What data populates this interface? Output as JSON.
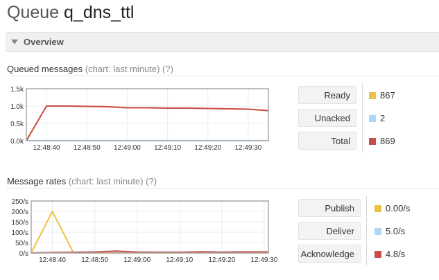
{
  "page": {
    "title_prefix": "Queue",
    "queue_name": "q_dns_ttl",
    "section_label": "Overview"
  },
  "queued": {
    "heading": "Queued messages",
    "chart_note": "(chart: last minute)",
    "help": "(?)",
    "stats": [
      {
        "label": "Ready",
        "value": "867",
        "color": "#edc240"
      },
      {
        "label": "Unacked",
        "value": "2",
        "color": "#afd8f8"
      },
      {
        "label": "Total",
        "value": "869",
        "color": "#cb4b4b"
      }
    ]
  },
  "rates": {
    "heading": "Message rates",
    "chart_note": "(chart: last minute)",
    "help": "(?)",
    "stats": [
      {
        "label": "Publish",
        "value": "0.00/s",
        "color": "#edc240"
      },
      {
        "label": "Deliver",
        "value": "5.0/s",
        "color": "#afd8f8"
      },
      {
        "label": "Acknowledge",
        "value": "4.8/s",
        "color": "#cb4b4b"
      }
    ]
  },
  "chart_data": [
    {
      "type": "line",
      "y_ticks": [
        "1.5k",
        "1.0k",
        "0.5k",
        "0.0k"
      ],
      "x_ticks": [
        "12:48:40",
        "12:48:50",
        "12:49:00",
        "12:49:10",
        "12:49:20",
        "12:49:30"
      ],
      "xlim": [
        "12:48:35",
        "12:49:35"
      ],
      "ylim": [
        0,
        1500
      ],
      "grid": true,
      "series": [
        {
          "color": "#edc240",
          "points": [
            [
              "12:48:35",
              0
            ],
            [
              "12:48:40",
              1000
            ],
            [
              "12:48:45",
              1000
            ],
            [
              "12:48:55",
              980
            ],
            [
              "12:49:00",
              950
            ],
            [
              "12:49:05",
              950
            ],
            [
              "12:49:10",
              940
            ],
            [
              "12:49:15",
              940
            ],
            [
              "12:49:20",
              930
            ],
            [
              "12:49:25",
              920
            ],
            [
              "12:49:30",
              910
            ],
            [
              "12:49:35",
              867
            ]
          ]
        },
        {
          "color": "#afd8f8",
          "points": [
            [
              "12:48:35",
              2
            ],
            [
              "12:49:35",
              2
            ]
          ]
        },
        {
          "color": "#cb4b4b",
          "points": [
            [
              "12:48:35",
              0
            ],
            [
              "12:48:40",
              1000
            ],
            [
              "12:48:45",
              1000
            ],
            [
              "12:48:55",
              980
            ],
            [
              "12:49:00",
              950
            ],
            [
              "12:49:05",
              950
            ],
            [
              "12:49:10",
              940
            ],
            [
              "12:49:15",
              940
            ],
            [
              "12:49:20",
              930
            ],
            [
              "12:49:25",
              920
            ],
            [
              "12:49:30",
              910
            ],
            [
              "12:49:35",
              869
            ]
          ]
        }
      ]
    },
    {
      "type": "line",
      "y_ticks": [
        "250/s",
        "200/s",
        "150/s",
        "100/s",
        "50/s",
        "0/s"
      ],
      "x_ticks": [
        "12:48:40",
        "12:48:50",
        "12:49:00",
        "12:49:10",
        "12:49:20",
        "12:49:30"
      ],
      "xlim": [
        "12:48:35",
        "12:49:31"
      ],
      "ylim": [
        0,
        250
      ],
      "grid": true,
      "series": [
        {
          "color": "#edc240",
          "points": [
            [
              "12:48:35",
              0
            ],
            [
              "12:48:40",
              200
            ],
            [
              "12:48:45",
              0
            ],
            [
              "12:49:31",
              0
            ]
          ]
        },
        {
          "color": "#afd8f8",
          "points": [
            [
              "12:48:35",
              0
            ],
            [
              "12:48:40",
              2
            ],
            [
              "12:48:45",
              4
            ],
            [
              "12:48:55",
              8
            ],
            [
              "12:49:00",
              5
            ],
            [
              "12:49:10",
              5
            ],
            [
              "12:49:20",
              6
            ],
            [
              "12:49:31",
              5
            ]
          ]
        },
        {
          "color": "#cb4b4b",
          "points": [
            [
              "12:48:35",
              0
            ],
            [
              "12:48:40",
              2
            ],
            [
              "12:48:45",
              3
            ],
            [
              "12:48:50",
              4
            ],
            [
              "12:48:55",
              9
            ],
            [
              "12:49:00",
              4
            ],
            [
              "12:49:05",
              3
            ],
            [
              "12:49:10",
              3
            ],
            [
              "12:49:15",
              6
            ],
            [
              "12:49:20",
              3
            ],
            [
              "12:49:25",
              5
            ],
            [
              "12:49:31",
              5
            ]
          ]
        }
      ]
    }
  ]
}
